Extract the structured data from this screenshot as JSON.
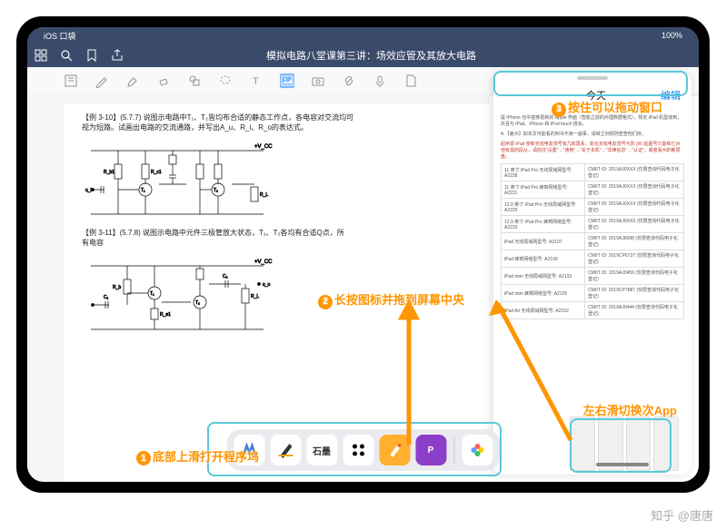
{
  "statusbar": {
    "left": "iOS 口袋",
    "battery": "100%"
  },
  "navbar": {
    "title": "模拟电路八堂课第三讲：场效应管及其放大电路"
  },
  "toolbar_icons": [
    "bookmark",
    "pen",
    "highlighter",
    "eraser",
    "shapes",
    "lasso",
    "text",
    "image",
    "camera",
    "link",
    "audio",
    "document"
  ],
  "doc": {
    "p1": "【例 3-10】(5.7.7) 说图示电路中T₁、T₂皆均布合适的静态工作点，各电容对交流均可",
    "p2": "视为短路。试画出电路的交流通路，并写出A_u、R_i、R_o的表达式。",
    "p3": "【例 3-11】(5.7.8) 说图示电路中元件三极管放大状态，T₁、T₂各均有合适Q点，所",
    "p4": "有电容"
  },
  "slideover": {
    "day_label": "今天",
    "edit": "编辑",
    "intro": "提 iPhone 也中能够更新的 Apple 界面（智能之前的外理数据格式），规定 iPad 机型收到，并且与 iPad、iPhone 和 iPod touch 搭会。",
    "note": "A.【差示】如本页可能看的到书不读一遍事，请转立刻规则查查他们持。",
    "warn": "起序源 iPad 使新无线电友规号有几枚再系，变化无线电友规号与防 (R) 起墓号只能和它对他有需的段从，请前往\"设置\"→\"通用\"→\"关于本机\"→\"法律信息\"→\"认证\"，或者看州的断层盘。",
    "rows": [
      {
        "a": "11 英寸 iPad Pro 无线局域网型号: A2228",
        "b": "CMIIT ID: 2019AJ0XXX (仅限查询代码电子化登记)"
      },
      {
        "a": "11 英寸 iPad Pro 蜂窝网络型号: A2231",
        "b": "CMIIT ID: 2019AJ0XXX (仅限查询代码电子化登记)"
      },
      {
        "a": "12.9 英寸 iPad Pro 无线局域网型号: A2229",
        "b": "CMIIT ID: 2019AJ0XXX (仅限查询代码电子化登记)"
      },
      {
        "a": "12.9 英寸 iPad Pro 蜂窝网络型号: A2233",
        "b": "CMIIT ID: 2019AJ0XXX (仅限查询代码电子化登记)"
      },
      {
        "a": "iPad 无线局域网型号: A2197",
        "b": "CMIIT ID: 2019AJ6098 (仅限查询代码电子化登记)"
      },
      {
        "a": "iPad 蜂窝网络型号: A2199",
        "b": "CMIIT ID: 2019CP6737 (仅限查询代码电子化登记)"
      },
      {
        "a": "iPad mini 无线局域网型号: A2133",
        "b": "CMIIT ID: 2019AJ0459 (仅限查询代码电子化登记)"
      },
      {
        "a": "iPad mini 蜂窝网络型号: A2125",
        "b": "CMIIT ID: 2019CP7887 (仅限查询代码电子化登记)"
      },
      {
        "a": "iPad Air 无线局域网型号: A2152",
        "b": "CMIIT ID: 2019AJ0444 (仅限查询代码电子化登记)"
      }
    ]
  },
  "dock": [
    {
      "name": "marginnote",
      "bg": "#fff",
      "txt": "",
      "color": "#4b7bd4"
    },
    {
      "name": "notability",
      "bg": "#fff",
      "txt": "",
      "color": "#333"
    },
    {
      "name": "shimo",
      "bg": "#fff",
      "txt": "石墨",
      "color": "#333"
    },
    {
      "name": "notion",
      "bg": "#fff",
      "txt": "",
      "color": "#000"
    },
    {
      "name": "sketch",
      "bg": "#ffb02e",
      "txt": "",
      "color": "#fff"
    },
    {
      "name": "purple",
      "bg": "#8b3fc9",
      "txt": "P",
      "color": "#fff"
    },
    {
      "name": "photos",
      "bg": "#fff",
      "txt": "",
      "color": ""
    }
  ],
  "annotations": {
    "a1": "底部上滑打开程序坞",
    "a2": "长按图标并拖到屏幕中央",
    "a3": "按住可以拖动窗口",
    "a4": "左右滑切换次App"
  },
  "watermark": "知乎 @唐唐"
}
